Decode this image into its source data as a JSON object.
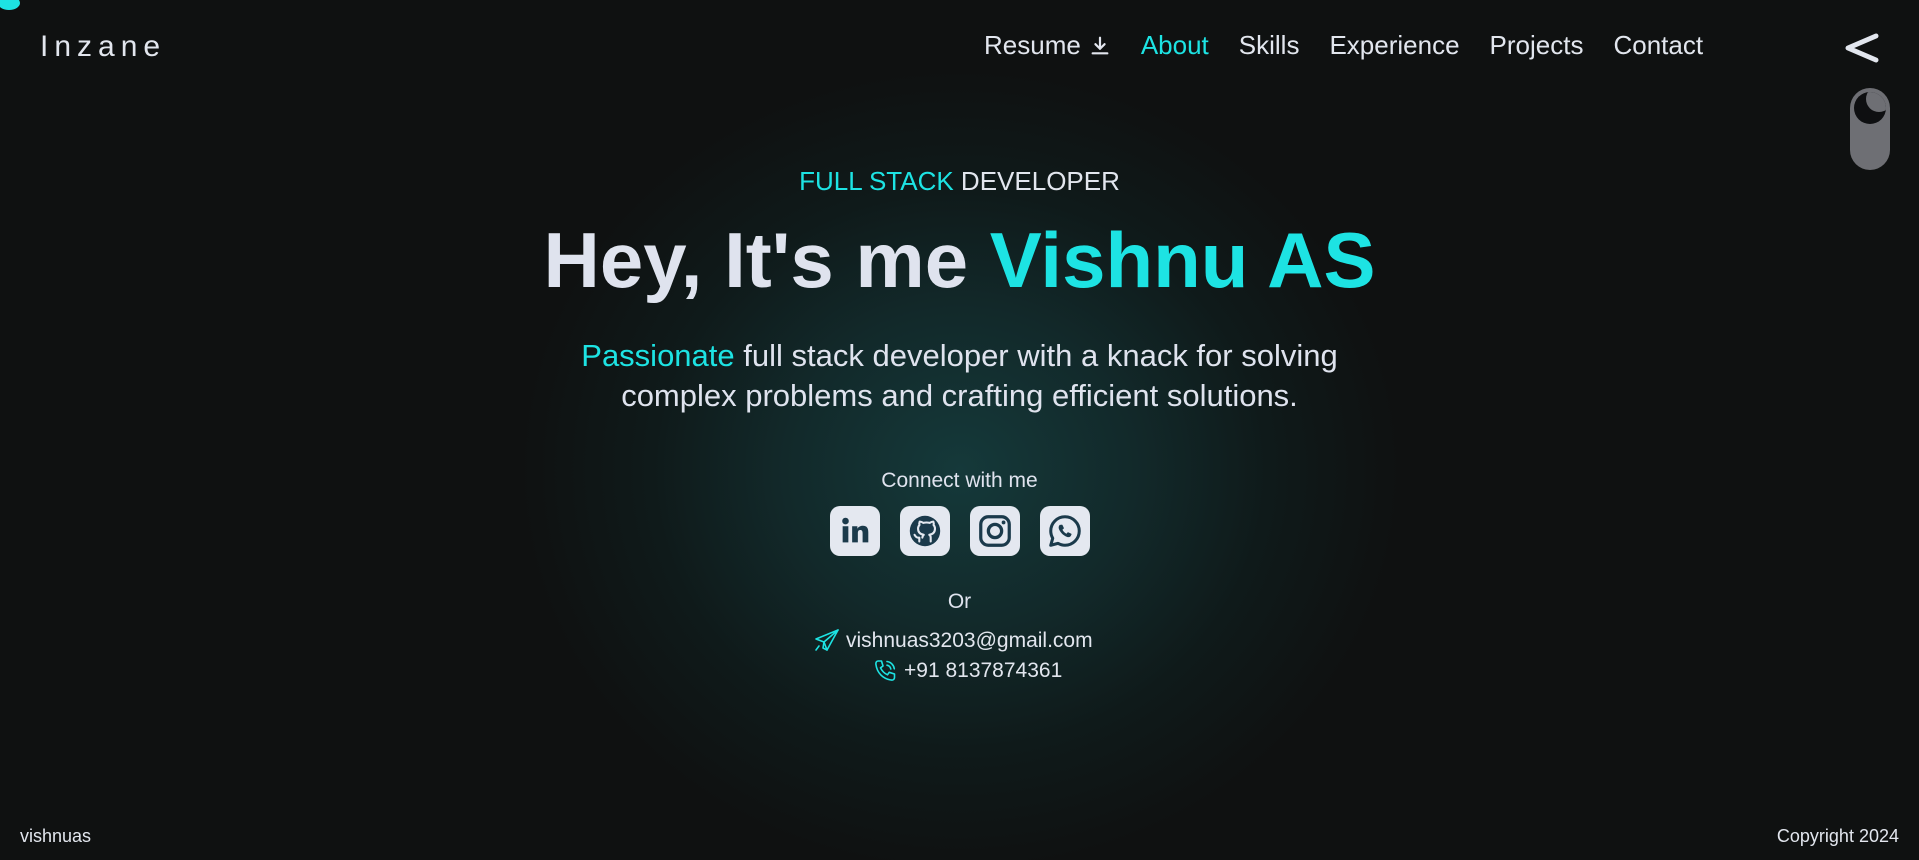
{
  "brand": {
    "name": "Inzane"
  },
  "nav": {
    "resume_label": "Resume",
    "items": [
      {
        "label": "About",
        "active": true
      },
      {
        "label": "Skills",
        "active": false
      },
      {
        "label": "Experience",
        "active": false
      },
      {
        "label": "Projects",
        "active": false
      },
      {
        "label": "Contact",
        "active": false
      }
    ]
  },
  "hero": {
    "role_accent": "FULL STACK",
    "role_rest": " DEVELOPER",
    "headline_prefix": "Hey, It's me ",
    "headline_name": "Vishnu AS",
    "tagline_accent": "Passionate",
    "tagline_line1_rest": " full stack developer with a knack for solving",
    "tagline_line2": "complex problems and crafting efficient solutions."
  },
  "connect": {
    "title": "Connect with me",
    "icons": [
      "linkedin-icon",
      "github-icon",
      "instagram-icon",
      "whatsapp-icon"
    ],
    "or_text": "Or",
    "email": "vishnuas3203@gmail.com",
    "phone": "+91 8137874361"
  },
  "footer": {
    "left": "vishnuas",
    "right": "Copyright 2024"
  },
  "colors": {
    "accent": "#1de3e3",
    "background": "#0f1111",
    "text": "#e2e6ee",
    "icon_bg": "#e4e8f0",
    "icon_fg": "#1b3a4b",
    "toggle": "#6e6f74"
  }
}
